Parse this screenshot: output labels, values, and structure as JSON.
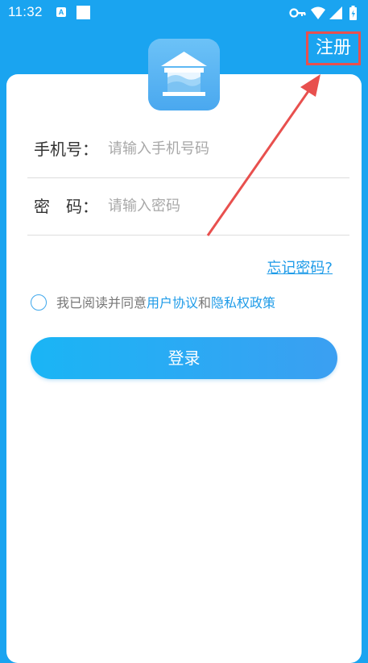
{
  "status_bar": {
    "time": "11:32",
    "notif_letter": "A",
    "battery_symbol": "⚡"
  },
  "header": {
    "register_label": "注册"
  },
  "form": {
    "phone": {
      "label": "手机号：",
      "placeholder": "请输入手机号码"
    },
    "password": {
      "label": "密　码：",
      "placeholder": "请输入密码"
    },
    "forgot_label": "忘记密码?"
  },
  "agreement": {
    "prefix": "我已阅读并同意",
    "user_agreement": "用户协议",
    "and": "和",
    "privacy_policy": "隐私权政策"
  },
  "login_button": {
    "label": "登录"
  },
  "colors": {
    "background": "#1aa4f0",
    "accent": "#1e9be8",
    "annotation": "#e8504e"
  },
  "icons": [
    "key-icon",
    "wifi-icon",
    "signal-icon",
    "battery-icon",
    "house-logo-icon",
    "radio-circle-icon"
  ]
}
